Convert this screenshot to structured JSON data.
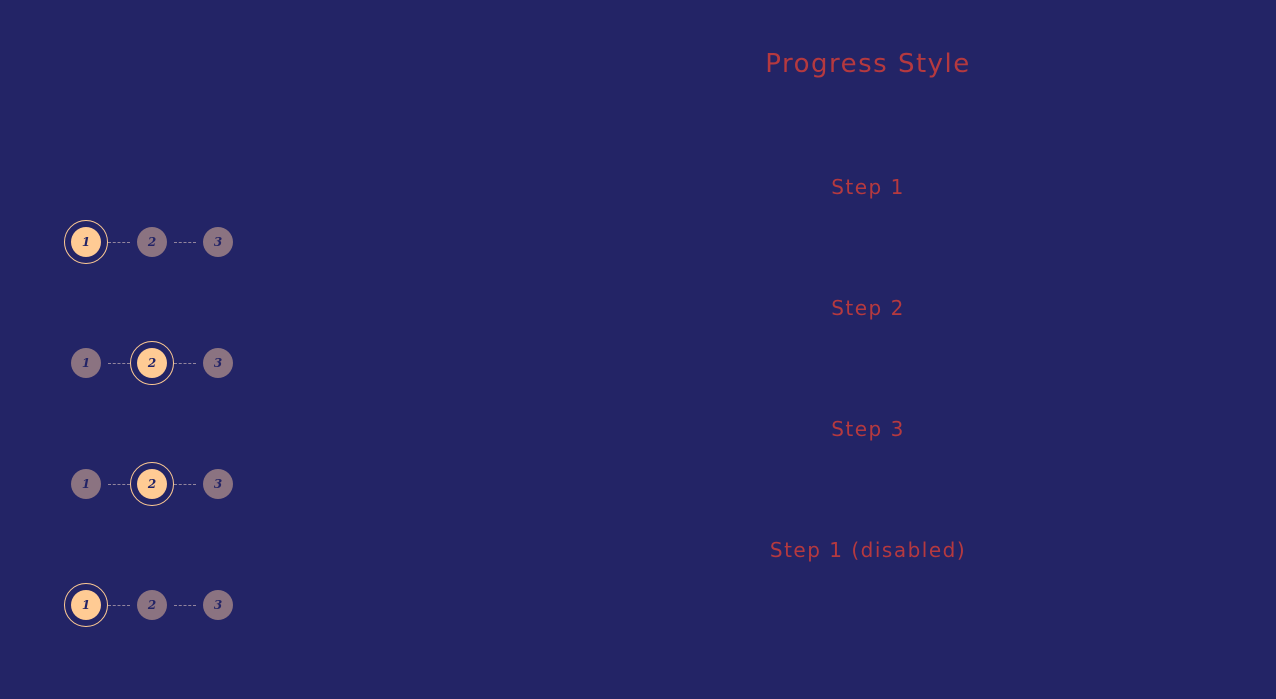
{
  "title": "Progress Style",
  "steppers": [
    {
      "label": "Step 1",
      "active_step": 1,
      "disabled": false,
      "steps": [
        "1",
        "2",
        "3"
      ]
    },
    {
      "label": "Step 2",
      "active_step": 2,
      "disabled": false,
      "steps": [
        "1",
        "2",
        "3"
      ]
    },
    {
      "label": "Step 3",
      "active_step": 2,
      "disabled": false,
      "steps": [
        "1",
        "2",
        "3"
      ]
    },
    {
      "label": "Step 1 (disabled)",
      "active_step": 1,
      "disabled": true,
      "steps": [
        "1",
        "2",
        "3"
      ]
    }
  ],
  "colors": {
    "background": "#232466",
    "label_text": "#b5393f",
    "active_step": "#ffcb94",
    "inactive_step": "#8b7381",
    "step_number": "#232466",
    "connector": "#b8a6b0"
  }
}
